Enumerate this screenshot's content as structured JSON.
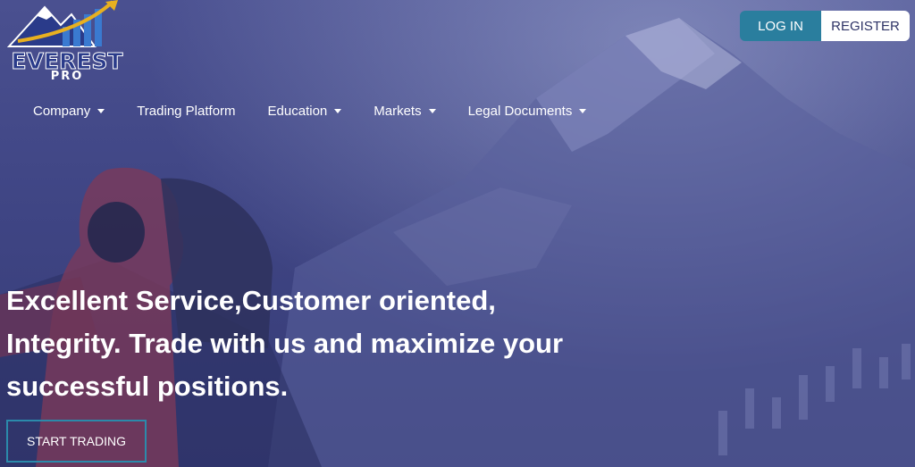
{
  "brand": {
    "name": "EVEREST",
    "suffix": "PRO",
    "colors": {
      "primary": "#2a3b8a",
      "accent": "#e8b020",
      "background": "#3a3f78"
    }
  },
  "auth": {
    "login_label": "LOG IN",
    "register_label": "REGISTER",
    "login_color": "#2a7e9e"
  },
  "nav": {
    "items": [
      {
        "label": "Company",
        "has_dropdown": true
      },
      {
        "label": "Trading Platform",
        "has_dropdown": false
      },
      {
        "label": "Education",
        "has_dropdown": true
      },
      {
        "label": "Markets",
        "has_dropdown": true
      },
      {
        "label": "Legal Documents",
        "has_dropdown": true
      }
    ]
  },
  "hero": {
    "headline_line1": "Excellent Service,Customer oriented,",
    "headline_line2": "Integrity. Trade with us and maximize your",
    "headline_line3": "successful positions.",
    "cta_label": "START TRADING",
    "cta_border_color": "#2b8aab"
  }
}
